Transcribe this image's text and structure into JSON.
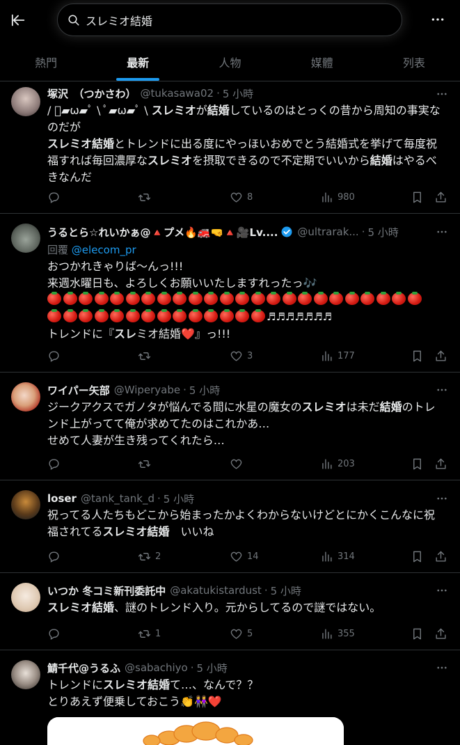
{
  "search": {
    "query": "スレミオ結婚"
  },
  "tabs": [
    "熱門",
    "最新",
    "人物",
    "媒體",
    "列表"
  ],
  "active_tab": 1,
  "tweets": [
    {
      "name": "塚沢　（つかさわ）",
      "handle": "@tukasawa02",
      "dot": "·",
      "time": "5 小時",
      "body": [
        "/ ﾟ▰ω▰ﾟ \\ ﾟ▰ω▰ﾟ \\ ",
        "スレミオ",
        "が",
        "結婚",
        "しているのはとっくの昔から周知の事実なのだが",
        "スレミオ結婚",
        "とトレンドに出る度にやっほいおめでとう結婚式を挙げて毎度祝福すれば毎回濃厚な",
        "スレミオ",
        "を摂取できるので不定期でいいから",
        "結婚",
        "はやるべきなんだ"
      ],
      "reply_count": "",
      "retweet_count": "",
      "like_count": "8",
      "view_count": "980"
    },
    {
      "name": "うるとら☆れいかぁ@🔺プメ🔥🚒🤜🔺🎥Lv....",
      "handle": "@ultrarak...",
      "dot": "·",
      "time": "5 小時",
      "reply_label": "回覆",
      "reply_handle": "@elecom_pr",
      "body_line1": "おつかれきゃりば〜んっ!!!",
      "body_line2": "来週水曜日も、よろしくお願いいたしますれったっ🎶",
      "notes": "♬♬♬♬♬♬♬",
      "body_line4_a": "トレンドに『",
      "body_line4_b": "スレ",
      "body_line4_c": "ミオ結婚",
      "body_line4_d": "❤️』っ!!!",
      "reply_count": "",
      "retweet_count": "",
      "like_count": "3",
      "view_count": "177"
    },
    {
      "name": "ワイパー矢部",
      "handle": "@Wiperyabe",
      "dot": "·",
      "time": "5 小時",
      "body": [
        "ジークアクスでガノタが悩んでる間に水星の魔女の",
        "スレミオ",
        "は未だ",
        "結婚",
        "のトレンド上がってて俺が求めてたのはこれかあ…",
        "せめて人妻が生き残ってくれたら…"
      ],
      "reply_count": "",
      "retweet_count": "",
      "like_count": "",
      "view_count": "203"
    },
    {
      "name": "loser",
      "handle": "@tank_tank_d",
      "dot": "·",
      "time": "5 小時",
      "body": [
        "祝ってる人たちもどこから始まったかよくわからないけどとにかくこんなに祝福されてる",
        "スレミオ結婚",
        "　いいね"
      ],
      "reply_count": "",
      "retweet_count": "2",
      "like_count": "14",
      "view_count": "314"
    },
    {
      "name": "いつか 冬コミ新刊委託中",
      "handle": "@akatukistardust",
      "dot": "·",
      "time": "5 小時",
      "body": [
        "スレミオ結婚",
        "、謎のトレンド入り。元からしてるので謎ではない。"
      ],
      "reply_count": "",
      "retweet_count": "1",
      "like_count": "5",
      "view_count": "355"
    },
    {
      "name": "鯖千代@うるふ",
      "handle": "@sabachiyo",
      "dot": "·",
      "time": "5 小時",
      "body": [
        "トレンドに",
        "スレミオ結婚",
        "て…、なんで？？",
        "とりあえず便乗しておこう👏👭❤️"
      ]
    }
  ],
  "colors": {
    "accent": "#1d9bf0",
    "muted": "#71767b",
    "text": "#e7e9ea",
    "divider": "#2f3336"
  },
  "icons": [
    "back-arrow-icon",
    "search-icon",
    "more-icon",
    "reply-icon",
    "retweet-icon",
    "like-icon",
    "views-icon",
    "bookmark-icon",
    "share-icon",
    "verified-badge-icon"
  ]
}
